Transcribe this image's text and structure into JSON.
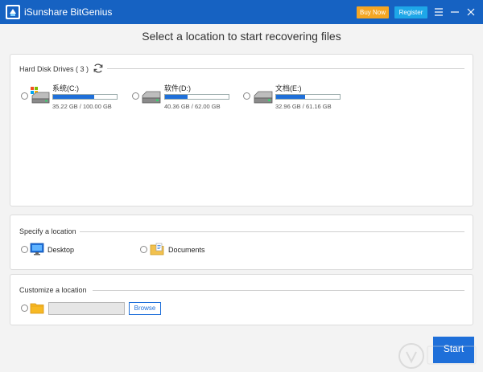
{
  "app": {
    "title": "iSunshare BitGenius"
  },
  "titlebar": {
    "buy_now_label": "Buy Now",
    "register_label": "Register",
    "menu_icon": "hamburger-menu-icon",
    "minimize_icon": "minimize-icon",
    "close_icon": "close-icon"
  },
  "heading": "Select a location to start recovering files",
  "hard_disks": {
    "title": "Hard Disk Drives ( 3 )",
    "refresh_icon": "refresh-icon",
    "drives": [
      {
        "name": "系统(C:)",
        "size": "35.22 GB / 100.00 GB",
        "used_fraction": 0.65,
        "os_drive": true
      },
      {
        "name": "软件(D:)",
        "size": "40.36 GB / 62.00 GB",
        "used_fraction": 0.35,
        "os_drive": false
      },
      {
        "name": "文档(E:)",
        "size": "32.96 GB / 61.16 GB",
        "used_fraction": 0.46,
        "os_drive": false
      }
    ]
  },
  "specify": {
    "title": "Specify a location",
    "desktop_label": "Desktop",
    "documents_label": "Documents"
  },
  "customize": {
    "title": "Customize a location",
    "path_value": "",
    "browse_label": "Browse"
  },
  "start_label": "Start",
  "colors": {
    "titlebar": "#1662c2",
    "accent": "#1e6fd9",
    "buy": "#f5a623",
    "register": "#1ea7e8"
  }
}
